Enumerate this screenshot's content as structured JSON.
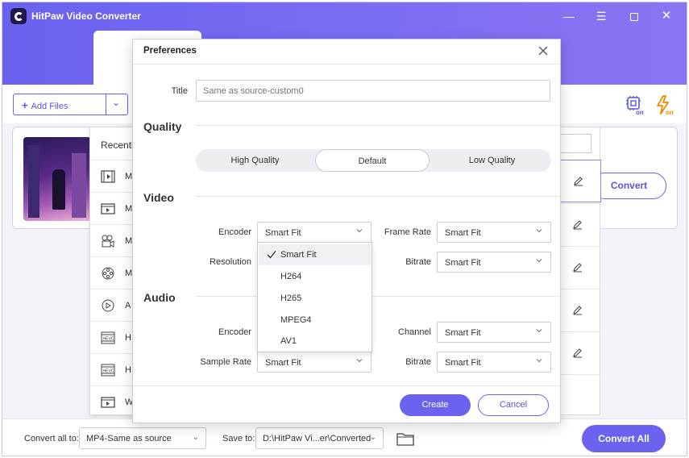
{
  "app": {
    "title": "HitPaw Video Converter"
  },
  "toolbar": {
    "add_files_label": "Add Files"
  },
  "file_card": {
    "convert_label": "Convert"
  },
  "recent_menu": {
    "title": "Recentl",
    "items": [
      {
        "label": "M",
        "icon": "video-file-icon"
      },
      {
        "label": "M",
        "icon": "video-screen-icon"
      },
      {
        "label": "M",
        "icon": "camera-icon"
      },
      {
        "label": "M",
        "icon": "film-reel-icon"
      },
      {
        "label": "A",
        "icon": "play-circle-icon"
      },
      {
        "label": "H",
        "icon": "heic-icon"
      },
      {
        "label": "H",
        "icon": "heic-icon"
      },
      {
        "label": "W",
        "icon": "video-screen-icon"
      }
    ]
  },
  "bottombar": {
    "convert_all_to_label": "Convert all to:",
    "convert_all_to_value": "MP4-Same as source",
    "save_to_label": "Save to:",
    "save_to_value": "D:\\HitPaw Vi...er\\Converted",
    "convert_all_label": "Convert All"
  },
  "preferences": {
    "title": "Preferences",
    "title_field_label": "Title",
    "title_placeholder": "Same as source-custom0",
    "quality": {
      "heading": "Quality",
      "options": [
        "High Quality",
        "Default",
        "Low Quality"
      ],
      "selected": "Default"
    },
    "video": {
      "heading": "Video",
      "encoder_label": "Encoder",
      "encoder_value": "Smart Fit",
      "frame_rate_label": "Frame Rate",
      "frame_rate_value": "Smart Fit",
      "resolution_label": "Resolution",
      "bitrate_label": "Bitrate",
      "bitrate_value": "Smart Fit"
    },
    "encoder_dropdown": {
      "options": [
        "Smart Fit",
        "H264",
        "H265",
        "MPEG4",
        "AV1"
      ],
      "selected": "Smart Fit"
    },
    "audio": {
      "heading": "Audio",
      "encoder_label": "Encoder",
      "channel_label": "Channel",
      "channel_value": "Smart Fit",
      "sample_rate_label": "Sample Rate",
      "sample_rate_value": "Smart Fit",
      "bitrate_label": "Bitrate",
      "bitrate_value": "Smart Fit"
    },
    "create_label": "Create",
    "cancel_label": "Cancel"
  },
  "colors": {
    "accent": "#6b63ef",
    "header_gradient_start": "#6a61ee",
    "header_gradient_end": "#8a74f2"
  }
}
